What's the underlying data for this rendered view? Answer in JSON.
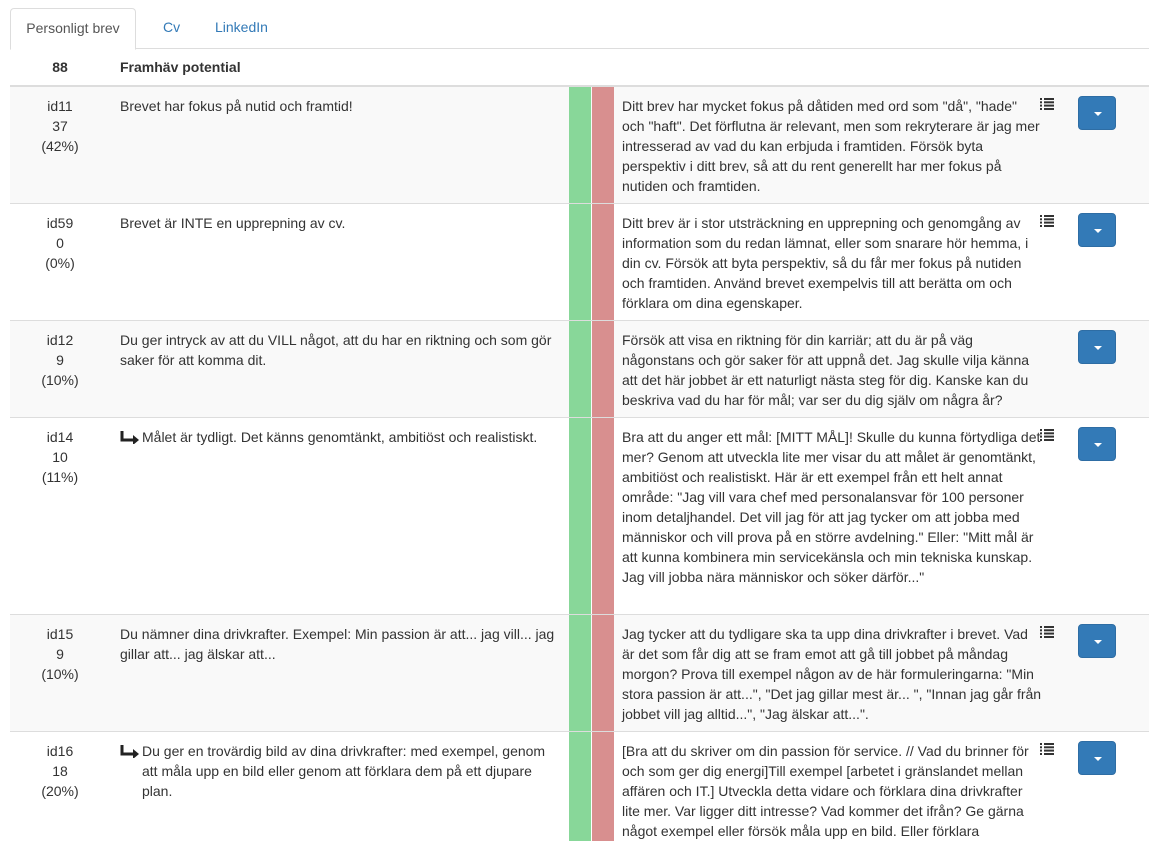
{
  "tabs": [
    "Personligt brev",
    "Cv",
    "LinkedIn"
  ],
  "header": {
    "count": "88",
    "title": "Framhäv potential"
  },
  "rows": [
    {
      "id": "id11",
      "count": "37",
      "pct": "(42%)",
      "desc": "Brevet har fokus på nutid och framtid!",
      "feedback": "Ditt brev har mycket fokus på dåtiden med ord som \"då\", \"hade\" och \"haft\". Det förflutna är relevant, men som rekryterare är jag mer intresserad av vad du kan erbjuda i framtiden. Försök byta perspektiv i ditt brev, så att du rent generellt har mer fokus på nutiden och framtiden."
    },
    {
      "id": "id59",
      "count": "0",
      "pct": "(0%)",
      "desc": "Brevet är INTE en upprepning av cv.",
      "feedback": "Ditt brev är i stor utsträckning en upprepning och genomgång av information som du redan lämnat, eller som snarare hör hemma, i din cv. Försök att byta perspektiv, så du får mer fokus på nutiden och framtiden. Använd brevet exempelvis till att berätta om och förklara om dina egenskaper."
    },
    {
      "id": "id12",
      "count": "9",
      "pct": "(10%)",
      "desc": "Du ger intryck av att du VILL något, att du har en riktning och som gör saker för att komma dit.",
      "feedback": "Försök att visa en riktning för din karriär; att du är på väg någonstans och gör saker för att uppnå det. Jag skulle vilja känna att det här jobbet är ett naturligt nästa steg för dig. Kanske kan du beskriva vad du har för mål; var ser du dig själv om några år?"
    },
    {
      "id": "id14",
      "count": "10",
      "pct": "(11%)",
      "desc": "Målet är tydligt. Det känns genomtänkt, ambitiöst och realistiskt.",
      "feedback": "Bra att du anger ett mål: [MITT MÅL]! Skulle du kunna förtydliga det mer? Genom att utveckla lite mer visar du att målet är genomtänkt, ambitiöst och realistiskt. Här är ett exempel från ett helt annat område: \"Jag vill vara chef med personalansvar för 100 personer inom detaljhandel. Det vill jag för att jag tycker om att jobba med människor och vill prova på en större avdelning.\" Eller: \"Mitt mål är att kunna kombinera min servicekänsla och min tekniska kunskap. Jag vill jobba nära människor och söker därför...\""
    },
    {
      "id": "id15",
      "count": "9",
      "pct": "(10%)",
      "desc": "Du nämner dina drivkrafter. Exempel: Min passion är att... jag vill... jag gillar att... jag älskar att...",
      "feedback": "Jag tycker att du tydligare ska ta upp dina drivkrafter i brevet. Vad är det som får dig att se fram emot att gå till jobbet på måndag morgon? Prova till exempel någon av de här formuleringarna: \"Min stora passion är att...\", \"Det jag gillar mest är... \", \"Innan jag går från jobbet vill jag alltid...\", \"Jag älskar att...\"."
    },
    {
      "id": "id16",
      "count": "18",
      "pct": "(20%)",
      "desc": "Du ger en trovärdig bild av dina drivkrafter: med exempel, genom att måla upp en bild eller genom att förklara dem på ett djupare plan.",
      "feedback": "[Bra att du skriver om din passion för service. // Vad du brinner för och som ger dig energi]Till exempel [arbetet i gränslandet mellan affären och IT.] Utveckla detta vidare och förklara dina drivkrafter lite mer. Var ligger ditt intresse? Vad kommer det ifrån? Ge gärna något exempel eller försök måla upp en bild. Eller förklara"
    }
  ],
  "colors": {
    "accent": "#337ab7",
    "positive": "#88d799",
    "negative": "#d88f8f"
  },
  "icons": {
    "sub": "arrow-turn-down-right-icon",
    "list": "list-icon",
    "dropdown": "caret-down-icon"
  }
}
